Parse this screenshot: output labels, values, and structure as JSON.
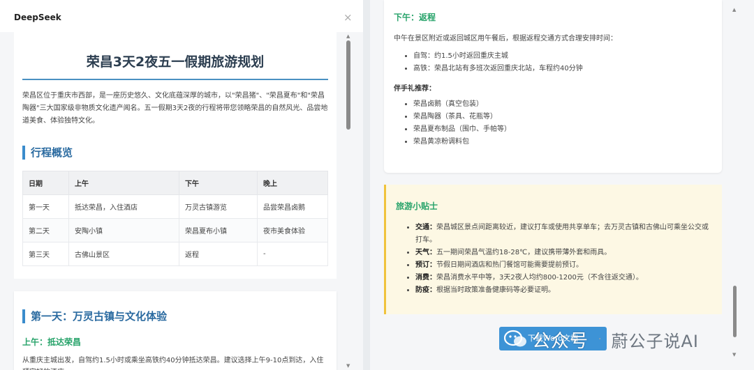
{
  "app": {
    "title": "DeepSeek",
    "close_glyph": "×"
  },
  "doc": {
    "title": "荣昌3天2夜五一假期旅游规划",
    "intro": "荣昌区位于重庆市西部，是一座历史悠久、文化底蕴深厚的城市，以\"荣昌猪\"、\"荣昌夏布\"和\"荣昌陶器\"三大国家级非物质文化遗产闻名。五一假期3天2夜的行程将带您领略荣昌的自然风光、品尝地道美食、体验独特文化。",
    "overview_title": "行程概览",
    "table": {
      "headers": [
        "日期",
        "上午",
        "下午",
        "晚上"
      ],
      "rows": [
        [
          "第一天",
          "抵达荣昌，入住酒店",
          "万灵古镇游览",
          "品尝荣昌卤鹅"
        ],
        [
          "第二天",
          "安陶小镇",
          "荣昌夏布小镇",
          "夜市美食体验"
        ],
        [
          "第三天",
          "古佛山景区",
          "返程",
          "-"
        ]
      ]
    },
    "day1": {
      "title": "第一天：万灵古镇与文化体验",
      "morning_title": "上午：抵达荣昌",
      "morning_text": "从重庆主城出发，自驾约1.5小时或乘坐高铁约40分钟抵达荣昌。建议选择上午9-10点到达，入住预定好的酒店。"
    }
  },
  "right": {
    "afternoon_title": "下午：返程",
    "afternoon_text": "中午在景区附近或返回城区用午餐后，根据返程交通方式合理安排时间：",
    "transport": [
      "自驾：约1.5小时返回重庆主城",
      "高铁：荣昌北站有多班次返回重庆北站，车程约40分钟"
    ],
    "souvenir_title": "伴手礼推荐：",
    "souvenirs": [
      "荣昌卤鹅（真空包装）",
      "荣昌陶器（茶具、花瓶等）",
      "荣昌夏布制品（围巾、手帕等）",
      "荣昌黄凉粉调料包"
    ],
    "tips_title": "旅游小贴士",
    "tips": [
      {
        "label": "交通：",
        "text": "荣昌城区景点间距离较近，建议打车或使用共享单车；去万灵古镇和古佛山可乘坐公交或打车。"
      },
      {
        "label": "天气：",
        "text": "五一期间荣昌气温约18-28℃，建议携带薄外套和雨具。"
      },
      {
        "label": "预订：",
        "text": "节假日期间酒店和热门餐馆可能需要提前预订。"
      },
      {
        "label": "消费：",
        "text": "荣昌消费水平中等，3天2夜人均约800-1200元（不含往返交通）。"
      },
      {
        "label": "防疫：",
        "text": "根据当时政策准备健康码等必要证明。"
      }
    ],
    "download_label": "下载Word文档"
  },
  "watermark": {
    "text": "公众号",
    "dot": "·",
    "author": "蔚公子说AI"
  },
  "colors": {
    "accent_blue": "#3a8ccc",
    "green": "#27a36a",
    "tips_bg": "#fdf8e4",
    "button": "#3d93d6"
  }
}
